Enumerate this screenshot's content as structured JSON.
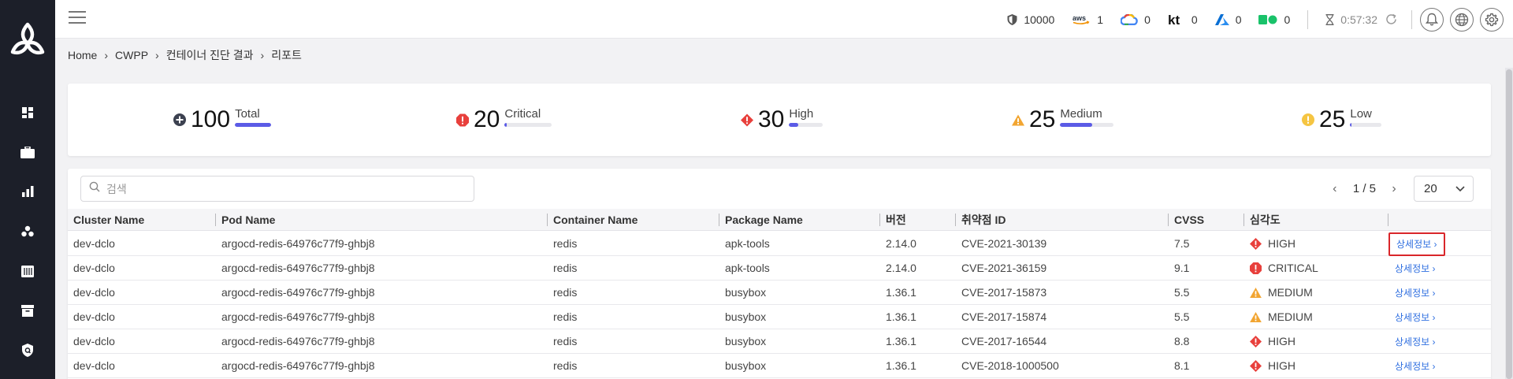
{
  "header": {
    "stats": [
      {
        "icon": "shield-icon",
        "value": "10000"
      },
      {
        "icon": "aws-icon",
        "value": "1"
      },
      {
        "icon": "gcp-icon",
        "value": "0"
      },
      {
        "icon": "kt-icon",
        "value": "0"
      },
      {
        "icon": "azure-icon",
        "value": "0"
      },
      {
        "icon": "ncloud-icon",
        "value": "0"
      }
    ],
    "timer": "0:57:32"
  },
  "breadcrumb": [
    "Home",
    "CWPP",
    "컨테이너 진단 결과",
    "리포트"
  ],
  "summary": {
    "total": {
      "value": "100",
      "label": "Total",
      "level": 1.0
    },
    "critical": {
      "value": "20",
      "label": "Critical",
      "level": 0.05
    },
    "high": {
      "value": "30",
      "label": "High",
      "level": 0.28
    },
    "medium": {
      "value": "25",
      "label": "Medium",
      "level": 0.6
    },
    "low": {
      "value": "25",
      "label": "Low",
      "level": 0.04
    }
  },
  "search": {
    "placeholder": "검색"
  },
  "pager": {
    "page": "1 / 5",
    "per_page": "20"
  },
  "table": {
    "columns": [
      "Cluster Name",
      "Pod Name",
      "Container Name",
      "Package Name",
      "버전",
      "취약점 ID",
      "CVSS",
      "심각도"
    ],
    "detail_label": "상세정보 ›",
    "rows": [
      {
        "cluster": "dev-dclo",
        "pod": "argocd-redis-64976c77f9-ghbj8",
        "container": "redis",
        "package": "apk-tools",
        "version": "2.14.0",
        "cve": "CVE-2021-30139",
        "cvss": "7.5",
        "severity": "HIGH",
        "sev_key": "high"
      },
      {
        "cluster": "dev-dclo",
        "pod": "argocd-redis-64976c77f9-ghbj8",
        "container": "redis",
        "package": "apk-tools",
        "version": "2.14.0",
        "cve": "CVE-2021-36159",
        "cvss": "9.1",
        "severity": "CRITICAL",
        "sev_key": "critical"
      },
      {
        "cluster": "dev-dclo",
        "pod": "argocd-redis-64976c77f9-ghbj8",
        "container": "redis",
        "package": "busybox",
        "version": "1.36.1",
        "cve": "CVE-2017-15873",
        "cvss": "5.5",
        "severity": "MEDIUM",
        "sev_key": "medium"
      },
      {
        "cluster": "dev-dclo",
        "pod": "argocd-redis-64976c77f9-ghbj8",
        "container": "redis",
        "package": "busybox",
        "version": "1.36.1",
        "cve": "CVE-2017-15874",
        "cvss": "5.5",
        "severity": "MEDIUM",
        "sev_key": "medium"
      },
      {
        "cluster": "dev-dclo",
        "pod": "argocd-redis-64976c77f9-ghbj8",
        "container": "redis",
        "package": "busybox",
        "version": "1.36.1",
        "cve": "CVE-2017-16544",
        "cvss": "8.8",
        "severity": "HIGH",
        "sev_key": "high"
      },
      {
        "cluster": "dev-dclo",
        "pod": "argocd-redis-64976c77f9-ghbj8",
        "container": "redis",
        "package": "busybox",
        "version": "1.36.1",
        "cve": "CVE-2018-1000500",
        "cvss": "8.1",
        "severity": "HIGH",
        "sev_key": "high"
      }
    ]
  },
  "colors": {
    "critical": "#e8403c",
    "high": "#e8403c",
    "medium": "#f2a531",
    "low": "#f5c542",
    "accent": "#5b5be6"
  }
}
